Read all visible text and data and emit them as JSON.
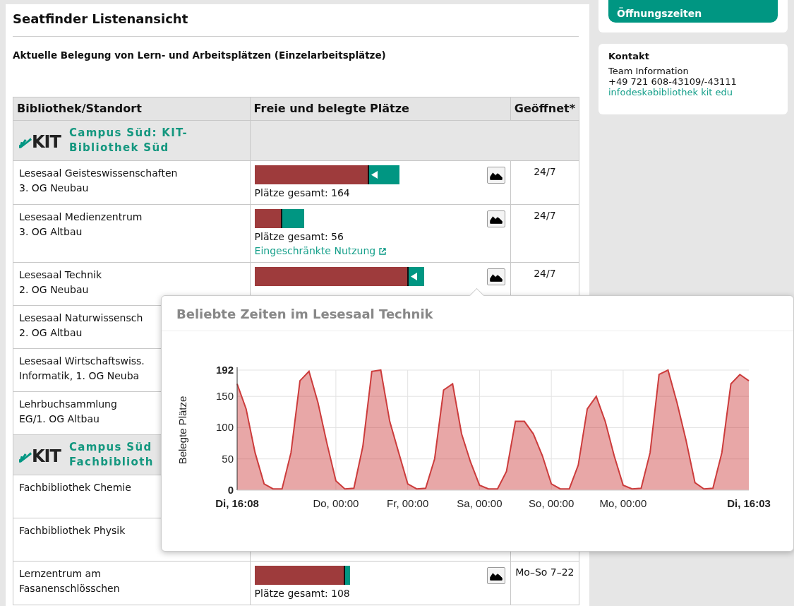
{
  "page": {
    "title": "Seatfinder Listenansicht",
    "subtitle": "Aktuelle Belegung von Lern- und Arbeitsplätzen (Einzelarbeitsplätze)"
  },
  "table": {
    "columns": [
      "Bibliothek/Standort",
      "Freie und belegte Plätze",
      "Geöffnet*"
    ],
    "rows": [
      {
        "kind": "group",
        "logo": "KIT",
        "lines": [
          "Campus Süd: KIT-",
          "Bibliothek Süd"
        ]
      },
      {
        "kind": "library",
        "lines": [
          "Lesesaal Geisteswissenschaften",
          "3. OG Neubau"
        ],
        "bar": {
          "fill": {
            "level": 0.79
          },
          "arrow": true
        },
        "total": "Plätze gesamt: 164",
        "chart_button": true,
        "opening": "24/7"
      },
      {
        "kind": "library",
        "lines": [
          "Lesesaal Medienzentrum",
          "3. OG Altbau"
        ],
        "bar": {
          "fill": {
            "level": 0.56
          },
          "arrow": false
        },
        "total": "Plätze gesamt: 56",
        "link": "Eingeschränkte Nutzung",
        "chart_button": true,
        "opening": "24/7"
      },
      {
        "kind": "library",
        "lines": [
          "Lesesaal Technik",
          "2. OG Neubau"
        ],
        "bar": {
          "fill": {
            "level": 0.91
          },
          "arrow": true
        },
        "chart_button": true,
        "opening": "24/7"
      },
      {
        "kind": "library",
        "lines": [
          "Lesesaal Naturwissensch",
          "2. OG Altbau"
        ]
      },
      {
        "kind": "library",
        "lines": [
          "Lesesaal Wirtschaftswiss.",
          "Informatik, 1. OG Neuba"
        ]
      },
      {
        "kind": "library",
        "lines": [
          "Lehrbuchsammlung",
          "EG/1. OG Altbau"
        ]
      },
      {
        "kind": "group",
        "logo": "KIT",
        "lines": [
          "Campus Süd",
          "Fachbiblioth"
        ]
      },
      {
        "kind": "library",
        "lines": [
          "Fachbibliothek Chemie"
        ]
      },
      {
        "kind": "library",
        "lines": [
          "Fachbibliothek Physik"
        ]
      },
      {
        "kind": "library",
        "lines": [
          "Lernzentrum am",
          "Fasanenschlösschen"
        ],
        "bar": {
          "fill": {
            "level": 0.95
          },
          "arrow": false
        },
        "total": "Plätze gesamt: 108",
        "chart_button": true,
        "opening": "Mo–So 7–22"
      }
    ]
  },
  "popup": {
    "title": "Beliebte Zeiten im Lesesaal Technik",
    "chart_data": {
      "type": "area",
      "ylabel": "Belegte Plätze",
      "categories": [
        "Di, 16:08",
        null,
        null,
        null,
        null,
        null,
        null,
        null,
        null,
        null,
        null,
        "Do, 00:00",
        null,
        null,
        null,
        null,
        null,
        null,
        null,
        "Fr, 00:00",
        null,
        null,
        null,
        null,
        null,
        null,
        null,
        "Sa, 00:00",
        null,
        null,
        null,
        null,
        null,
        null,
        null,
        "So, 00:00",
        null,
        null,
        null,
        null,
        null,
        null,
        null,
        "Mo, 00:00",
        null,
        null,
        null,
        null,
        null,
        null,
        null,
        null,
        null,
        null,
        null,
        null,
        null,
        "Di, 16:03"
      ],
      "series": [
        {
          "color": "#cc3c3c",
          "values": [
            170,
            130,
            60,
            10,
            2,
            2,
            60,
            175,
            190,
            140,
            75,
            15,
            2,
            3,
            70,
            190,
            192,
            110,
            60,
            10,
            2,
            3,
            50,
            160,
            170,
            90,
            45,
            8,
            2,
            2,
            30,
            110,
            110,
            90,
            55,
            10,
            2,
            2,
            40,
            130,
            150,
            110,
            55,
            8,
            2,
            3,
            60,
            185,
            192,
            140,
            80,
            12,
            2,
            3,
            60,
            170,
            185,
            175
          ]
        }
      ],
      "ylim": [
        0,
        192
      ],
      "grid": true,
      "yticks": [
        0,
        50,
        100,
        150,
        192
      ]
    }
  },
  "sidebar": {
    "hours_button": "Öffnungszeiten",
    "contact": {
      "title": "Kontakt",
      "name": "Team Information",
      "phone": "+49 721 608-43109/-43111",
      "email": "infodeskəbibliothek kit edu"
    }
  }
}
